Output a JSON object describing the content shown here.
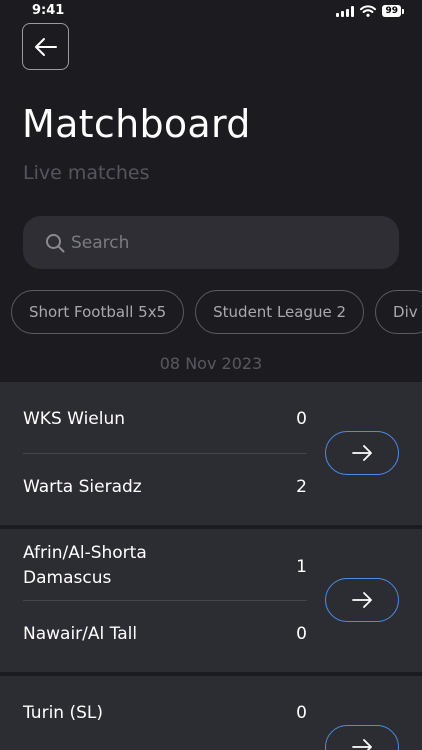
{
  "status_bar": {
    "time": "9:41",
    "battery": "99"
  },
  "header": {
    "title": "Matchboard",
    "subtitle": "Live matches"
  },
  "search": {
    "placeholder": "Search"
  },
  "filters": [
    "Short Football 5x5",
    "Student League 2",
    "Div"
  ],
  "date": "08 Nov 2023",
  "matches": [
    {
      "home": "WKS Wielun",
      "home_score": "0",
      "away": "Warta Sieradz",
      "away_score": "2"
    },
    {
      "home": "Afrin/Al-Shorta Damascus",
      "home_score": "1",
      "away": "Nawair/Al Tall",
      "away_score": "0"
    },
    {
      "home": "Turin (SL)",
      "home_score": "0"
    }
  ],
  "colors": {
    "background": "#1c1c20",
    "card": "#2c2c33",
    "accent": "#4d8ce6"
  },
  "icons": {
    "back": "arrow-left-icon",
    "search": "search-icon",
    "open": "arrow-right-icon"
  }
}
